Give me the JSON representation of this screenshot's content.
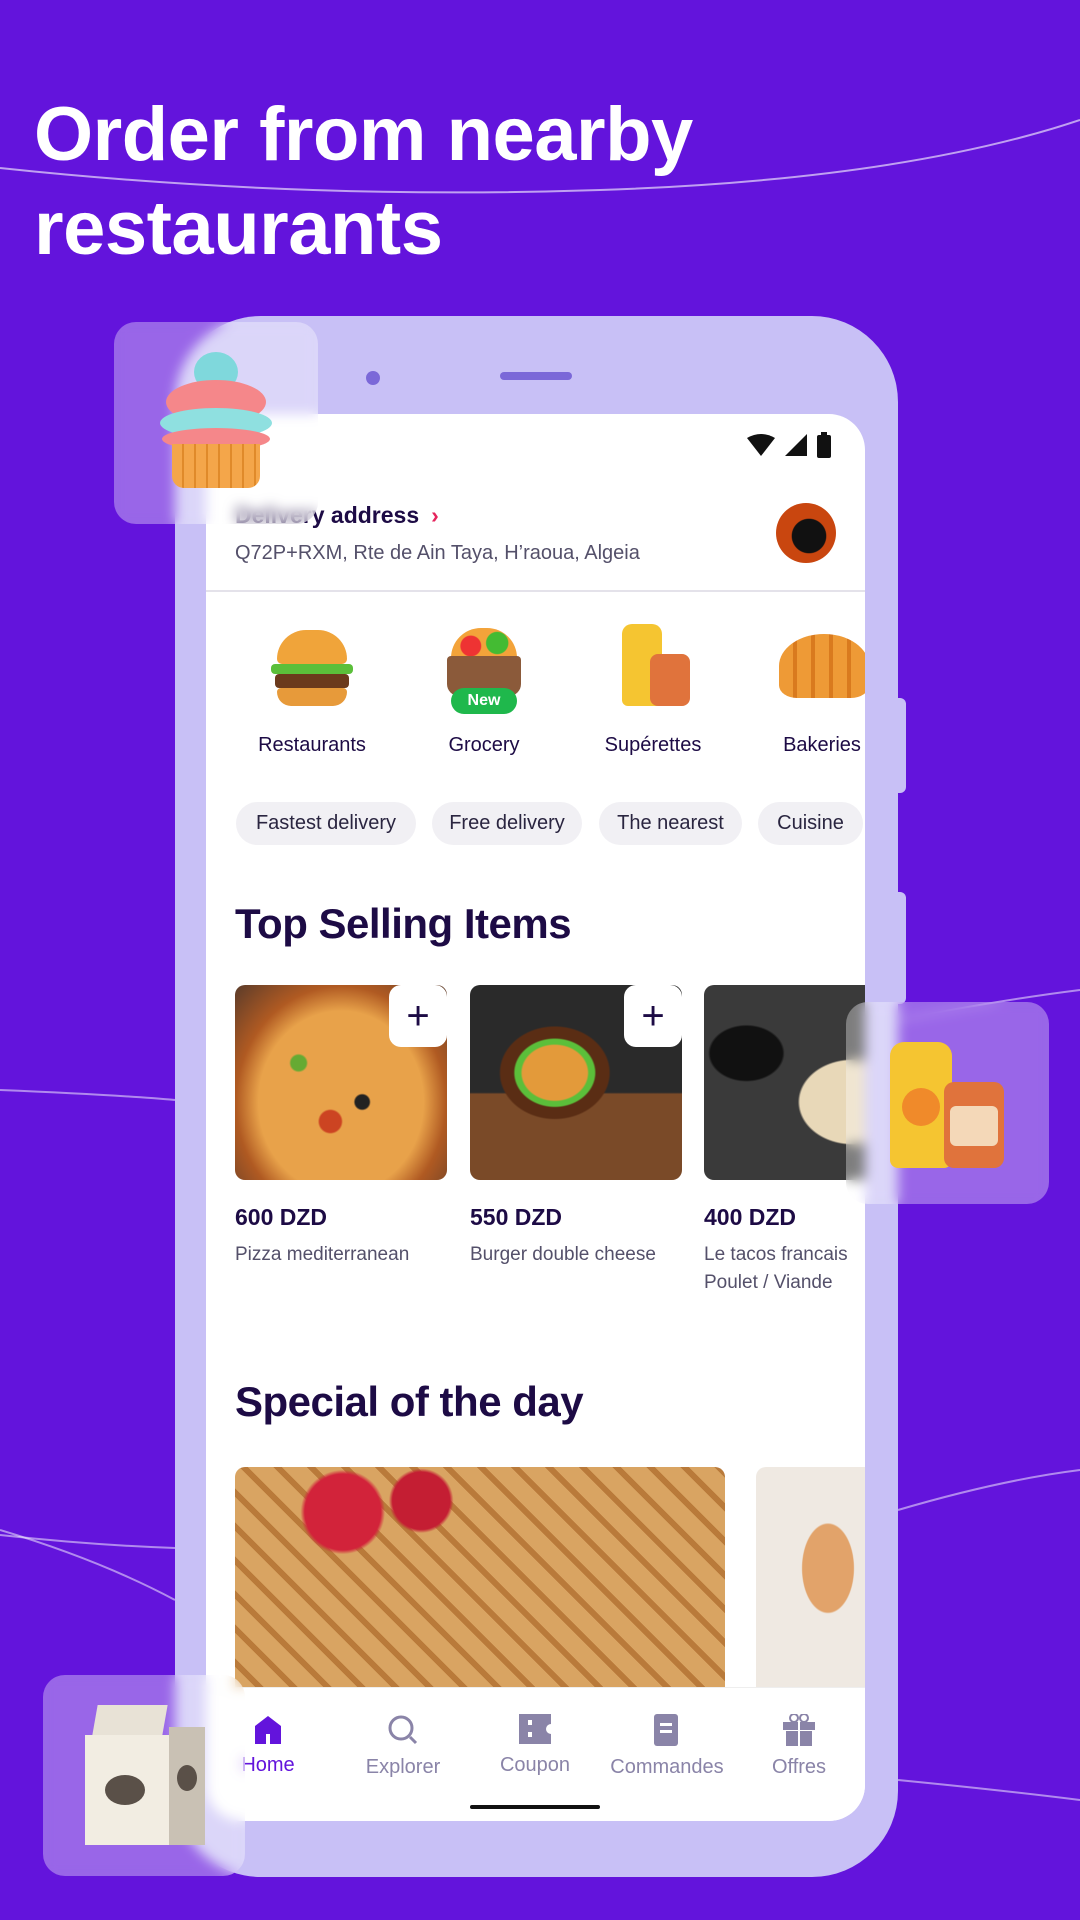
{
  "headline": {
    "line1": "Order from nearby",
    "line2": "restaurants"
  },
  "colors": {
    "background": "#6314dc",
    "accent": "#6314dc",
    "phone_frame": "#c8c0f6",
    "chevron": "#e5245c",
    "new_badge": "#1fb84c"
  },
  "status_bar": {
    "icons": [
      "wifi-icon",
      "signal-icon",
      "battery-icon"
    ]
  },
  "header": {
    "title": "Delivery address",
    "address": "Q72P+RXM, Rte de Ain Taya, H’raoua, Algeia"
  },
  "categories": [
    {
      "label": "Restaurants",
      "icon": "burger-icon"
    },
    {
      "label": "Grocery",
      "icon": "grocery-basket-icon",
      "badge": "New"
    },
    {
      "label": "Supérettes",
      "icon": "juice-jar-icon"
    },
    {
      "label": "Bakeries",
      "icon": "croissant-icon"
    }
  ],
  "filters": [
    "Fastest delivery",
    "Free delivery",
    "The nearest",
    "Cuisine"
  ],
  "top_selling": {
    "title": "Top Selling Items",
    "items": [
      {
        "price": "600 DZD",
        "name": "Pizza mediterranean"
      },
      {
        "price": "550 DZD",
        "name": "Burger double cheese"
      },
      {
        "price": "400 DZD",
        "name": "Le tacos francais",
        "name2": "Poulet / Viande"
      }
    ]
  },
  "special": {
    "title": "Special of the day"
  },
  "nav": [
    {
      "label": "Home",
      "icon": "home-icon",
      "active": true
    },
    {
      "label": "Explorer",
      "icon": "search-icon"
    },
    {
      "label": "Coupon",
      "icon": "ticket-icon"
    },
    {
      "label": "Commandes",
      "icon": "receipt-icon"
    },
    {
      "label": "Offres",
      "icon": "gift-icon"
    }
  ]
}
